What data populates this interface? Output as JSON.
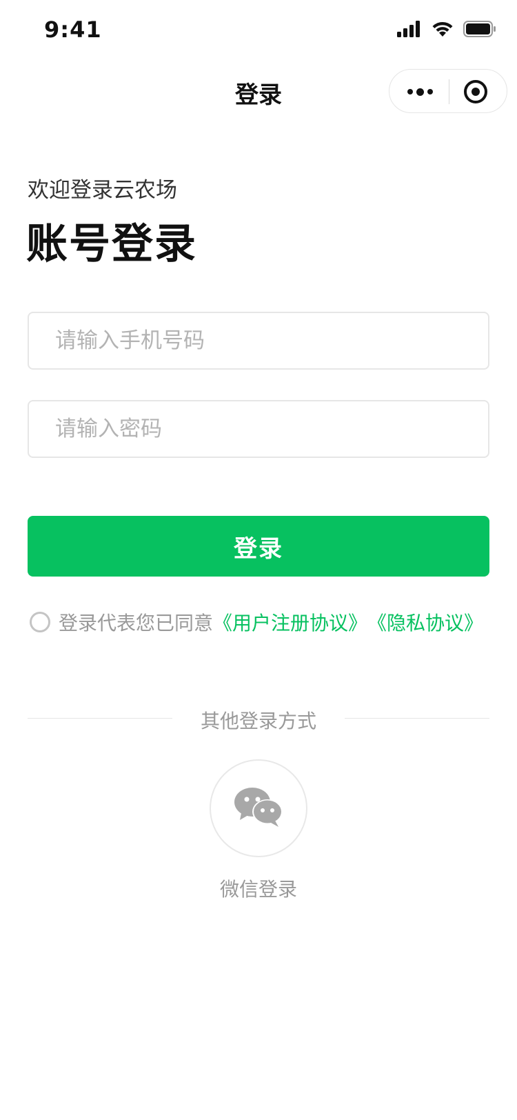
{
  "status_bar": {
    "time": "9:41",
    "icons": [
      "signal-icon",
      "wifi-icon",
      "battery-icon"
    ]
  },
  "nav": {
    "title": "登录",
    "capsule": [
      "more-icon",
      "close-miniprogram-icon"
    ]
  },
  "main": {
    "welcome": "欢迎登录云农场",
    "heading": "账号登录",
    "phone_placeholder": "请输入手机号码",
    "password_placeholder": "请输入密码",
    "login_button": "登录",
    "agreement": {
      "prefix": "登录代表您已同意",
      "user_agreement": "《用户注册协议》",
      "privacy_agreement": "《隐私协议》"
    },
    "other_login": {
      "divider_text": "其他登录方式",
      "wechat_label": "微信登录",
      "wechat_icon": "wechat-icon"
    }
  },
  "colors": {
    "primary": "#07c160",
    "text_dark": "#111111",
    "text_secondary": "#999999",
    "border": "#e6e6e6",
    "icon_gray": "#a8a8a8"
  }
}
